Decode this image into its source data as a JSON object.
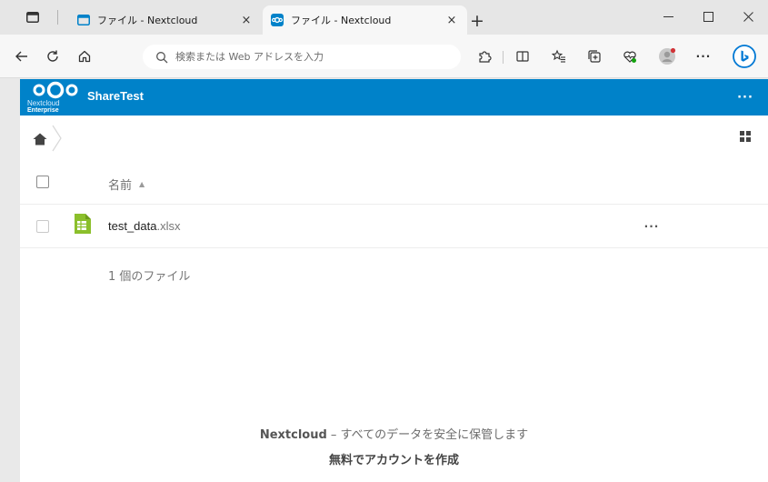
{
  "browser": {
    "tabs": [
      {
        "title": "ファイル - Nextcloud",
        "active": false
      },
      {
        "title": "ファイル - Nextcloud",
        "active": true
      }
    ],
    "close_glyph": "×",
    "new_tab_glyph": "+",
    "window_controls": {
      "minimize": "—",
      "maximize": "☐",
      "close": "✕"
    },
    "address_placeholder": "検索または Web アドレスを入力",
    "more_glyph": "···",
    "accent": "#0078d4"
  },
  "app": {
    "logo": {
      "line1": "Nextcloud",
      "line2": "Enterprise"
    },
    "title": "ShareTest",
    "header_menu": "···",
    "brand_color": "#0082c9"
  },
  "files": {
    "column_name": "名前",
    "sort_indicator": "▲",
    "items": [
      {
        "name": "test_data",
        "ext": ".xlsx",
        "icon": "spreadsheet-icon",
        "menu": "···"
      }
    ],
    "summary": "1 個のファイル"
  },
  "footer": {
    "brand": "Nextcloud",
    "tagline": " – すべてのデータを安全に保管します",
    "cta": "無料でアカウントを作成"
  }
}
